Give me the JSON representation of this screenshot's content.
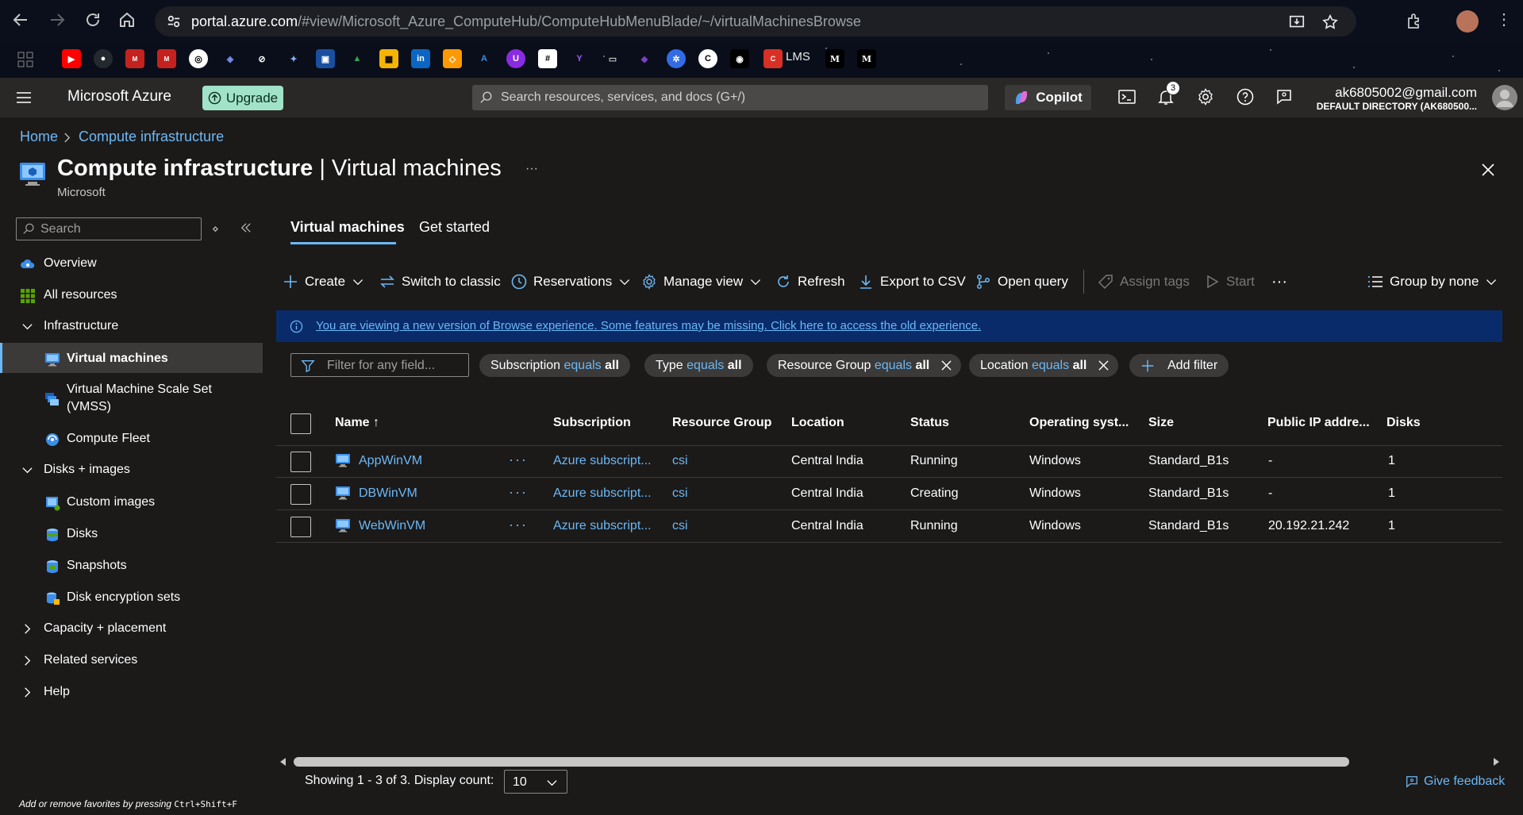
{
  "browser": {
    "url_host": "portal.azure.com",
    "url_path": "/#view/Microsoft_Azure_ComputeHub/ComputeHubMenuBlade/~/virtualMachinesBrowse",
    "bookmarks": [
      "LMS"
    ]
  },
  "header": {
    "app_title": "Microsoft Azure",
    "upgrade_label": "Upgrade",
    "search_placeholder": "Search resources, services, and docs (G+/)",
    "copilot_label": "Copilot",
    "notifications_count": "3",
    "account_email": "ak6805002@gmail.com",
    "account_directory": "DEFAULT DIRECTORY (AK680500..."
  },
  "breadcrumb": [
    "Home",
    "Compute infrastructure"
  ],
  "page": {
    "title_bold": "Compute infrastructure",
    "title_rest": " | Virtual machines",
    "subtitle": "Microsoft",
    "more": "···"
  },
  "sidebar": {
    "search_placeholder": "Search",
    "items": [
      {
        "label": "Overview"
      },
      {
        "label": "All resources"
      },
      {
        "label": "Infrastructure"
      },
      {
        "label": "Virtual machines"
      },
      {
        "label": "Virtual Machine Scale Set"
      },
      {
        "label": "(VMSS)"
      },
      {
        "label": "Compute Fleet"
      },
      {
        "label": "Disks + images"
      },
      {
        "label": "Custom images"
      },
      {
        "label": "Disks"
      },
      {
        "label": "Snapshots"
      },
      {
        "label": "Disk encryption sets"
      },
      {
        "label": "Capacity + placement"
      },
      {
        "label": "Related services"
      },
      {
        "label": "Help"
      }
    ],
    "fav_hint_prefix": "Add or remove favorites by pressing ",
    "fav_hint_keys": "Ctrl+Shift+F"
  },
  "tabs": [
    {
      "label": "Virtual machines",
      "selected": true
    },
    {
      "label": "Get started",
      "selected": false
    }
  ],
  "toolbar": {
    "create": "Create",
    "switch_classic": "Switch to classic",
    "reservations": "Reservations",
    "manage_view": "Manage view",
    "refresh": "Refresh",
    "export_csv": "Export to CSV",
    "open_query": "Open query",
    "assign_tags": "Assign tags",
    "start": "Start",
    "more": "···",
    "group_by": "Group by none"
  },
  "banner": {
    "text": "You are viewing a new version of Browse experience. Some features may be missing. Click here to access the old experience."
  },
  "filters": {
    "placeholder": "Filter for any field...",
    "pills": [
      {
        "field": "Subscription",
        "op": "equals",
        "value": "all"
      },
      {
        "field": "Type",
        "op": "equals",
        "value": "all"
      },
      {
        "field": "Resource Group",
        "op": "equals",
        "value": "all"
      },
      {
        "field": "Location",
        "op": "equals",
        "value": "all"
      }
    ],
    "add_filter": "Add filter"
  },
  "table": {
    "columns": [
      "Name",
      "Subscription",
      "Resource Group",
      "Location",
      "Status",
      "Operating syst...",
      "Size",
      "Public IP addre...",
      "Disks"
    ],
    "sort_indicator": "↑",
    "rows": [
      {
        "name": "AppWinVM",
        "more": "···",
        "subscription": "Azure subscript...",
        "resource_group": "csi",
        "location": "Central India",
        "status": "Running",
        "os": "Windows",
        "size": "Standard_B1s",
        "public_ip": "-",
        "disks": "1"
      },
      {
        "name": "DBWinVM",
        "more": "···",
        "subscription": "Azure subscript...",
        "resource_group": "csi",
        "location": "Central India",
        "status": "Creating",
        "os": "Windows",
        "size": "Standard_B1s",
        "public_ip": "-",
        "disks": "1"
      },
      {
        "name": "WebWinVM",
        "more": "···",
        "subscription": "Azure subscript...",
        "resource_group": "csi",
        "location": "Central India",
        "status": "Running",
        "os": "Windows",
        "size": "Standard_B1s",
        "public_ip": "20.192.21.242",
        "disks": "1"
      }
    ]
  },
  "footer": {
    "showing": "Showing 1 - 3 of 3. Display count:",
    "display_count": "10",
    "feedback": "Give feedback"
  },
  "colors": {
    "accent": "#6cb8f6",
    "background": "#1b1a19",
    "header": "#292827",
    "banner": "#0a2b6a",
    "upgrade": "#a1e3c9"
  }
}
